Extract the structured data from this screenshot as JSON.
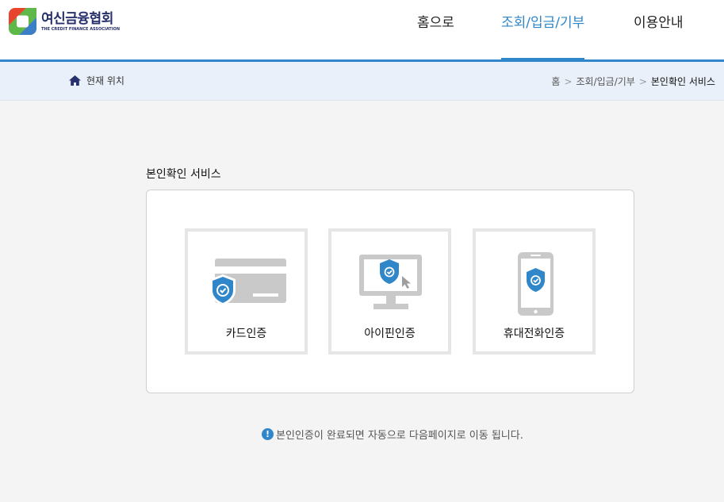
{
  "header": {
    "logo_ko": "여신금융협회",
    "logo_en": "THE CREDIT FINANCE ASSOCIATION",
    "nav": [
      {
        "label": "홈으로",
        "active": false
      },
      {
        "label": "조회/입금/기부",
        "active": true
      },
      {
        "label": "이용안내",
        "active": false
      }
    ]
  },
  "location": {
    "label": "현재 위치",
    "crumbs": [
      "홈",
      "조회/입금/기부",
      "본인확인 서비스"
    ],
    "separator": ">"
  },
  "main": {
    "title": "본인확인 서비스",
    "cards": [
      {
        "label": "카드인증",
        "icon": "credit-card-shield-icon"
      },
      {
        "label": "아이핀인증",
        "icon": "monitor-shield-icon"
      },
      {
        "label": "휴대전화인증",
        "icon": "phone-shield-icon"
      }
    ],
    "notice": "본인인증이 완료되면 자동으로 다음페이지로 이동 됩니다.",
    "notice_icon": "!"
  },
  "colors": {
    "accent": "#2f86c9",
    "brand_navy": "#26306b",
    "icon_gray": "#c9c9c9"
  }
}
